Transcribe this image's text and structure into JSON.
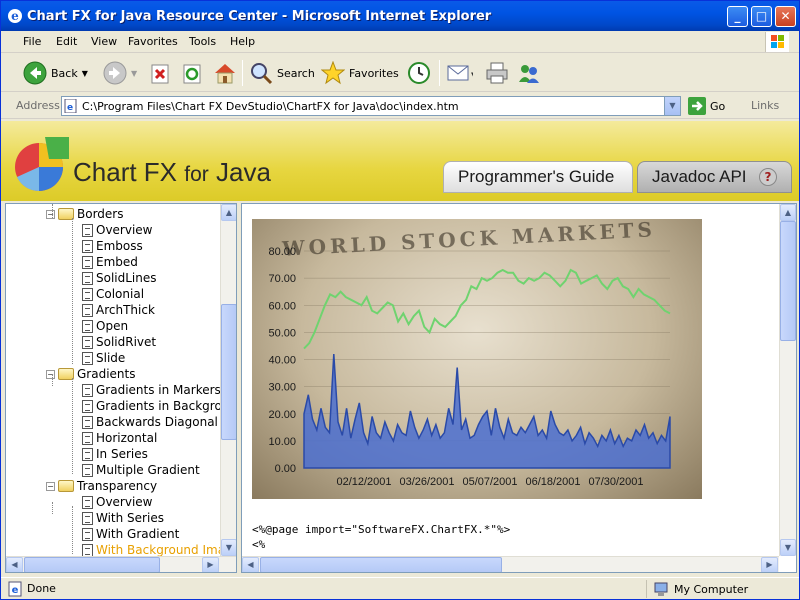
{
  "window": {
    "title": "Chart FX for Java Resource Center - Microsoft Internet Explorer",
    "minimize": "_",
    "maximize": "□",
    "close": "✕"
  },
  "menu": [
    "File",
    "Edit",
    "View",
    "Favorites",
    "Tools",
    "Help"
  ],
  "toolbar": {
    "back": "Back",
    "search": "Search",
    "favorites": "Favorites"
  },
  "address": {
    "label": "Address",
    "url": "C:\\Program Files\\Chart FX DevStudio\\ChartFX for Java\\doc\\index.htm",
    "go": "Go",
    "links": "Links"
  },
  "banner": {
    "brand_main": "Chart FX",
    "brand_for": "for",
    "brand_java": "Java",
    "tab1": "Programmer's Guide",
    "tab2": "Javadoc API",
    "help": "?"
  },
  "tree": [
    {
      "label": "Borders",
      "type": "folder"
    },
    {
      "label": "Overview",
      "type": "doc"
    },
    {
      "label": "Emboss",
      "type": "doc"
    },
    {
      "label": "Embed",
      "type": "doc"
    },
    {
      "label": "SolidLines",
      "type": "doc"
    },
    {
      "label": "Colonial",
      "type": "doc"
    },
    {
      "label": "ArchThick",
      "type": "doc"
    },
    {
      "label": "Open",
      "type": "doc"
    },
    {
      "label": "SolidRivet",
      "type": "doc"
    },
    {
      "label": "Slide",
      "type": "doc"
    },
    {
      "label": "Gradients",
      "type": "folder"
    },
    {
      "label": "Gradients in Markers",
      "type": "doc"
    },
    {
      "label": "Gradients in Backgrou",
      "type": "doc"
    },
    {
      "label": "Backwards Diagonal",
      "type": "doc"
    },
    {
      "label": "Horizontal",
      "type": "doc"
    },
    {
      "label": "In Series",
      "type": "doc"
    },
    {
      "label": "Multiple Gradient",
      "type": "doc"
    },
    {
      "label": "Transparency",
      "type": "folder"
    },
    {
      "label": "Overview",
      "type": "doc"
    },
    {
      "label": "With Series",
      "type": "doc"
    },
    {
      "label": "With Gradient",
      "type": "doc"
    },
    {
      "label": "With Background Imag",
      "type": "doc",
      "selected": true
    }
  ],
  "chart_headline": "WORLD STOCK MARKETS",
  "chart_data": {
    "type": "area",
    "y_ticks": [
      "80.00",
      "70.00",
      "60.00",
      "50.00",
      "40.00",
      "30.00",
      "20.00",
      "10.00",
      "0.00"
    ],
    "ylim": [
      0,
      80
    ],
    "x_ticks": [
      "02/12/2001",
      "03/26/2001",
      "05/07/2001",
      "06/18/2001",
      "07/30/2001"
    ],
    "series": [
      {
        "type": "line",
        "color": "#6fd36f",
        "values": [
          44,
          46,
          50,
          55,
          60,
          64,
          63,
          65,
          63,
          62,
          61,
          60,
          63,
          58,
          57,
          59,
          61,
          60,
          54,
          57,
          53,
          56,
          58,
          52,
          50,
          55,
          53,
          52,
          54,
          56,
          60,
          62,
          67,
          66,
          70,
          69,
          70,
          72,
          73,
          72,
          72,
          69,
          68,
          70,
          69,
          70,
          72,
          71,
          69,
          67,
          69,
          73,
          72,
          68,
          69,
          70,
          71,
          68,
          66,
          69,
          70,
          67,
          66,
          63,
          66,
          64,
          63,
          62,
          60,
          58,
          57
        ]
      },
      {
        "type": "area",
        "color": "#4b6fd0",
        "values": [
          20,
          27,
          18,
          14,
          22,
          15,
          13,
          42,
          17,
          12,
          22,
          11,
          18,
          24,
          13,
          9,
          19,
          13,
          11,
          17,
          13,
          10,
          16,
          13,
          12,
          21,
          15,
          11,
          14,
          18,
          12,
          16,
          11,
          13,
          22,
          16,
          37,
          14,
          18,
          11,
          12,
          16,
          19,
          21,
          12,
          22,
          15,
          11,
          18,
          13,
          12,
          15,
          13,
          16,
          19,
          12,
          14,
          11,
          21,
          16,
          13,
          12,
          14,
          10,
          12,
          15,
          9,
          13,
          11,
          8,
          12,
          10,
          14,
          9,
          12,
          8,
          11,
          10,
          14,
          12,
          16,
          11,
          13,
          9,
          12,
          10,
          19
        ]
      }
    ]
  },
  "code_lines": [
    "<%@page import=\"SoftwareFX.ChartFX.*\"%>",
    "<%"
  ],
  "status": {
    "text": "Done",
    "zone": "My Computer"
  }
}
